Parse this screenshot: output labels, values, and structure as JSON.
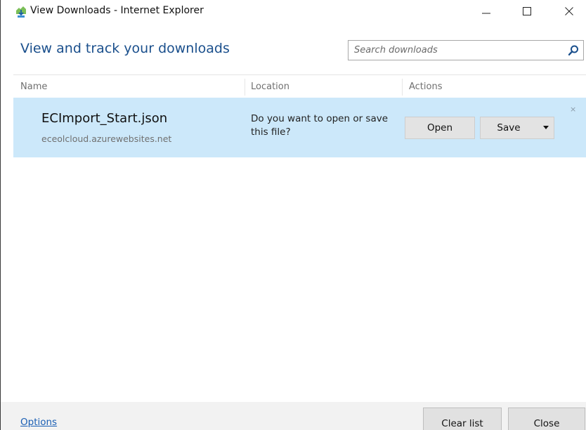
{
  "window": {
    "title": "View Downloads - Internet Explorer",
    "minimize_glyph": "—",
    "maximize_glyph": "☐",
    "close_glyph": "✕"
  },
  "header": {
    "title": "View and track your downloads",
    "search_placeholder": "Search downloads",
    "search_icon": "search-icon"
  },
  "columns": {
    "name": "Name",
    "location": "Location",
    "actions": "Actions"
  },
  "downloads": [
    {
      "file_name": "ECImport_Start.json",
      "source": "eceolcloud.azurewebsites.net",
      "prompt": "Do you want to open or save this file?",
      "open_label": "Open",
      "save_label": "Save",
      "dismiss_glyph": "×"
    }
  ],
  "footer": {
    "options_label": "Options",
    "clear_list_label": "Clear list",
    "close_label": "Close"
  },
  "colors": {
    "accent": "#1a4f8c",
    "row_highlight": "#cce8fa",
    "link": "#1a5fb4"
  }
}
